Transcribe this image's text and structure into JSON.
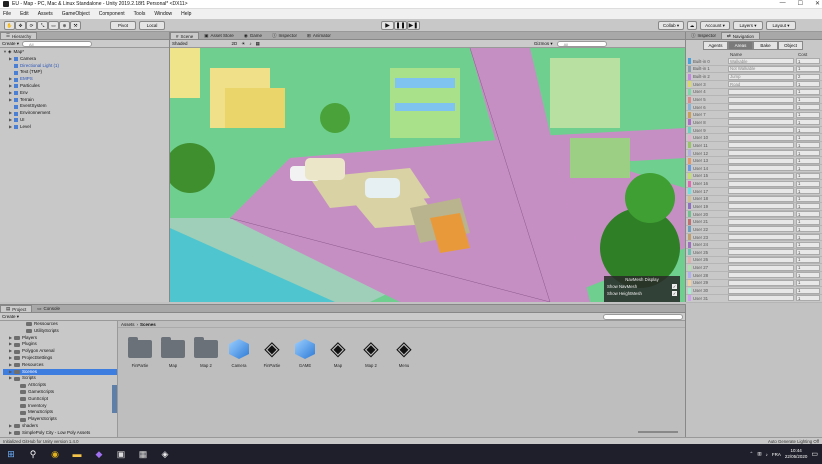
{
  "window": {
    "title": "EU - Map - PC, Mac & Linux Standalone - Unity 2019.2.18f1 Personal* <DX11>"
  },
  "menu": [
    "File",
    "Edit",
    "Assets",
    "GameObject",
    "Component",
    "Tools",
    "Window",
    "Help"
  ],
  "toolbar": {
    "pivot": "Pivot",
    "space": "Local",
    "collab": "Collab ▾",
    "account": "Account ▾",
    "layers": "Layers ▾",
    "layout": "Layout ▾"
  },
  "hierarchy": {
    "tab": "Hierarchy",
    "create": "Create ▾",
    "search_placeholder": "All",
    "scene": "Map*",
    "items": [
      "Camera",
      "Directional Light (1)",
      "Text (TMP)",
      "EMPS",
      "Particules",
      "Env",
      "Terrain",
      "EventSystem",
      "Environnement",
      "UI",
      "Level"
    ]
  },
  "scene_tabs": [
    "Scene",
    "Asset Store",
    "Game",
    "Inspector",
    "Animator"
  ],
  "scene_bar": {
    "shading": "Shaded",
    "persp": "2D",
    "gizmos": "Gizmos ▾",
    "search": "All"
  },
  "navmesh": {
    "title": "NavMesh Display",
    "show_navmesh": "Show NavMesh",
    "show_heightmesh": "Show HeightMesh"
  },
  "nav": {
    "tabs": [
      "Inspector",
      "Navigation"
    ],
    "subtabs": [
      "Agents",
      "Areas",
      "Bake",
      "Object"
    ],
    "col_name": "Name",
    "col_cost": "Cost",
    "rows": [
      {
        "label": "Built-in 0",
        "name": "Walkable",
        "cost": "1",
        "color": "#4aa3d8"
      },
      {
        "label": "Built-in 1",
        "name": "Not Walkable",
        "cost": "1",
        "color": "#8aa0ae"
      },
      {
        "label": "Built-in 2",
        "name": "Jump",
        "cost": "2",
        "color": "#c28adf"
      },
      {
        "label": "User 3",
        "name": "Road",
        "cost": "1",
        "color": "#d9d96a"
      },
      {
        "label": "User 4",
        "name": "",
        "cost": "1",
        "color": "#7fd6a8"
      },
      {
        "label": "User 5",
        "name": "",
        "cost": "1",
        "color": "#d78a8a"
      },
      {
        "label": "User 6",
        "name": "",
        "cost": "1",
        "color": "#8ab4d6"
      },
      {
        "label": "User 7",
        "name": "",
        "cost": "1",
        "color": "#c7a05c"
      },
      {
        "label": "User 8",
        "name": "",
        "cost": "1",
        "color": "#a86fc4"
      },
      {
        "label": "User 9",
        "name": "",
        "cost": "1",
        "color": "#6ad0c2"
      },
      {
        "label": "User 10",
        "name": "",
        "cost": "1",
        "color": "#e3b0d0"
      },
      {
        "label": "User 11",
        "name": "",
        "cost": "1",
        "color": "#9ac46a"
      },
      {
        "label": "User 12",
        "name": "",
        "cost": "1",
        "color": "#b0b0e0"
      },
      {
        "label": "User 13",
        "name": "",
        "cost": "1",
        "color": "#e09a6a"
      },
      {
        "label": "User 14",
        "name": "",
        "cost": "1",
        "color": "#6a9ae0"
      },
      {
        "label": "User 15",
        "name": "",
        "cost": "1",
        "color": "#c0e06a"
      },
      {
        "label": "User 16",
        "name": "",
        "cost": "1",
        "color": "#e06ab0"
      },
      {
        "label": "User 17",
        "name": "",
        "cost": "1",
        "color": "#6ae0e0"
      },
      {
        "label": "User 18",
        "name": "",
        "cost": "1",
        "color": "#d0c090"
      },
      {
        "label": "User 19",
        "name": "",
        "cost": "1",
        "color": "#9070c0"
      },
      {
        "label": "User 20",
        "name": "",
        "cost": "1",
        "color": "#70c090"
      },
      {
        "label": "User 21",
        "name": "",
        "cost": "1",
        "color": "#c07070"
      },
      {
        "label": "User 22",
        "name": "",
        "cost": "1",
        "color": "#70a0c0"
      },
      {
        "label": "User 23",
        "name": "",
        "cost": "1",
        "color": "#c0a070"
      },
      {
        "label": "User 24",
        "name": "",
        "cost": "1",
        "color": "#a070c0"
      },
      {
        "label": "User 25",
        "name": "",
        "cost": "1",
        "color": "#70c0b0"
      },
      {
        "label": "User 26",
        "name": "",
        "cost": "1",
        "color": "#e0b0b0"
      },
      {
        "label": "User 27",
        "name": "",
        "cost": "1",
        "color": "#b0e0b0"
      },
      {
        "label": "User 28",
        "name": "",
        "cost": "1",
        "color": "#b0b0f0"
      },
      {
        "label": "User 29",
        "name": "",
        "cost": "1",
        "color": "#f0d0a0"
      },
      {
        "label": "User 30",
        "name": "",
        "cost": "1",
        "color": "#a0f0d0"
      },
      {
        "label": "User 31",
        "name": "",
        "cost": "1",
        "color": "#d0a0f0"
      }
    ]
  },
  "project": {
    "tabs": [
      "Project",
      "Console"
    ],
    "create": "Create ▾",
    "breadcrumb": [
      "Assets",
      "Scenes"
    ],
    "tree": [
      {
        "label": "Ressources",
        "depth": 3
      },
      {
        "label": "UtilityScripts",
        "depth": 3
      },
      {
        "label": "Players",
        "depth": 1
      },
      {
        "label": "Plugins",
        "depth": 1
      },
      {
        "label": "Polygon Arsenal",
        "depth": 1
      },
      {
        "label": "ProjectSettings",
        "depth": 1
      },
      {
        "label": "Resources",
        "depth": 1
      },
      {
        "label": "Scenes",
        "depth": 1,
        "selected": true
      },
      {
        "label": "Scripts",
        "depth": 1
      },
      {
        "label": "AIScripts",
        "depth": 2
      },
      {
        "label": "GameScripts",
        "depth": 2
      },
      {
        "label": "GunScript",
        "depth": 2
      },
      {
        "label": "Inventory",
        "depth": 2
      },
      {
        "label": "MenuScripts",
        "depth": 2
      },
      {
        "label": "PlayersScripts",
        "depth": 2
      },
      {
        "label": "shaders",
        "depth": 1
      },
      {
        "label": "SimplePoly City - Low Poly Assets",
        "depth": 1
      }
    ],
    "assets": [
      {
        "label": "FinPartie",
        "kind": "folder"
      },
      {
        "label": "Map",
        "kind": "folder"
      },
      {
        "label": "Map 2",
        "kind": "folder"
      },
      {
        "label": "Camera",
        "kind": "mesh"
      },
      {
        "label": "FinPartie",
        "kind": "unity"
      },
      {
        "label": "GAME",
        "kind": "mesh"
      },
      {
        "label": "Map",
        "kind": "unity"
      },
      {
        "label": "Map 2",
        "kind": "unity"
      },
      {
        "label": "Menu",
        "kind": "unity"
      }
    ]
  },
  "status": {
    "left": "Initialized GitHub for Unity version 1.4.0",
    "right": "Auto Generate Lighting Off"
  },
  "taskbar": {
    "time": "10:44",
    "date": "22/05/2020",
    "lang": "FRA"
  }
}
